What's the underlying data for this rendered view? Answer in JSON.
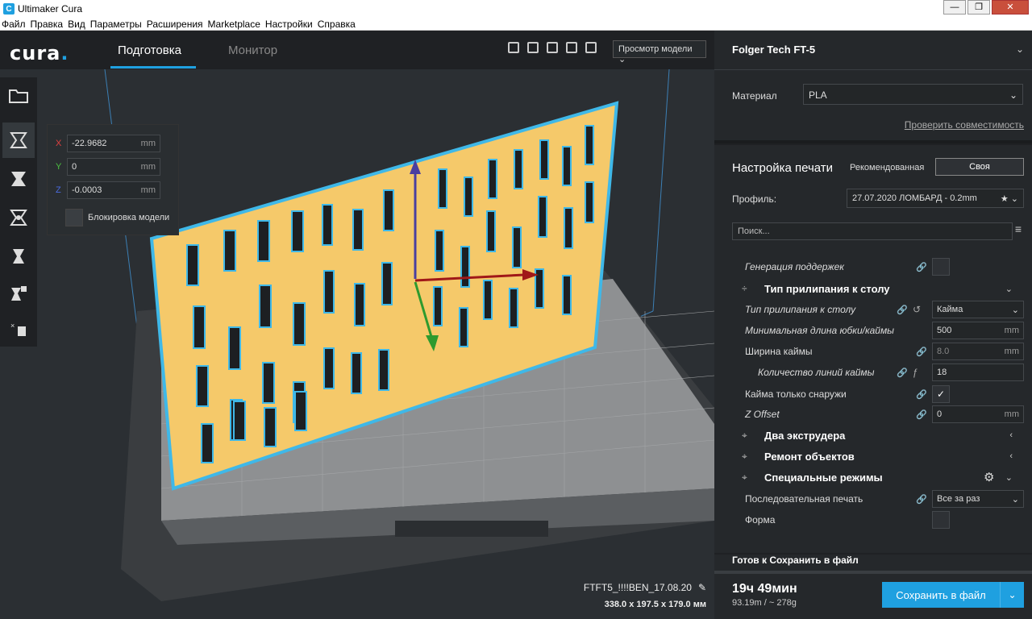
{
  "window": {
    "title": "Ultimaker Cura"
  },
  "menu": [
    "Файл",
    "Правка",
    "Вид",
    "Параметры",
    "Расширения",
    "Marketplace",
    "Настройки",
    "Справка"
  ],
  "header": {
    "logo": "cura",
    "tabs": [
      {
        "label": "Подготовка",
        "active": true
      },
      {
        "label": "Монитор",
        "active": false
      }
    ],
    "view_select": "Просмотр модели"
  },
  "move_panel": {
    "x_label": "X",
    "x_value": "-22.9682",
    "y_label": "Y",
    "y_value": "0",
    "z_label": "Z",
    "z_value": "-0.0003",
    "unit": "mm",
    "lock_label": "Блокировка модели"
  },
  "job": {
    "name": "FTFT5_!!!!BEN_17.08.20",
    "dims": "338.0 x 197.5 x 179.0 мм"
  },
  "printer": {
    "name": "Folger Tech FT-5",
    "material_label": "Материал",
    "material_value": "PLA",
    "compat_link": "Проверить совместимость"
  },
  "print_settings": {
    "title": "Настройка печати",
    "mode_recommended": "Рекомендованная",
    "mode_custom": "Своя",
    "profile_label": "Профиль:",
    "profile_value": "27.07.2020 ЛОМБАРД - 0.2mm",
    "search_placeholder": "Поиск...",
    "rows": {
      "support": "Генерация поддержек",
      "adhesion_cat": "Тип прилипания к столу",
      "adhesion_type": "Тип прилипания к столу",
      "adhesion_type_value": "Кайма",
      "skirt_min_len": "Минимальная длина юбки/каймы",
      "skirt_min_len_value": "500",
      "brim_width": "Ширина каймы",
      "brim_width_value": "8.0",
      "brim_lines": "Количество линий каймы",
      "brim_lines_value": "18",
      "brim_outside": "Кайма только снаружи",
      "z_offset": "Z Offset",
      "z_offset_value": "0",
      "dual": "Два экструдера",
      "repair": "Ремонт объектов",
      "special": "Специальные режимы",
      "sequence": "Последовательная печать",
      "sequence_value": "Все за раз",
      "form": "Форма",
      "unit_mm": "mm"
    }
  },
  "bottom": {
    "status": "Готов к Сохранить в файл",
    "time": "19ч 49мин",
    "usage": "93.19m / ~ 278g",
    "save_label": "Сохранить в файл"
  },
  "colors": {
    "accent": "#1fa0e0",
    "model": "#f5c96a",
    "outline": "#3fb8e8"
  }
}
